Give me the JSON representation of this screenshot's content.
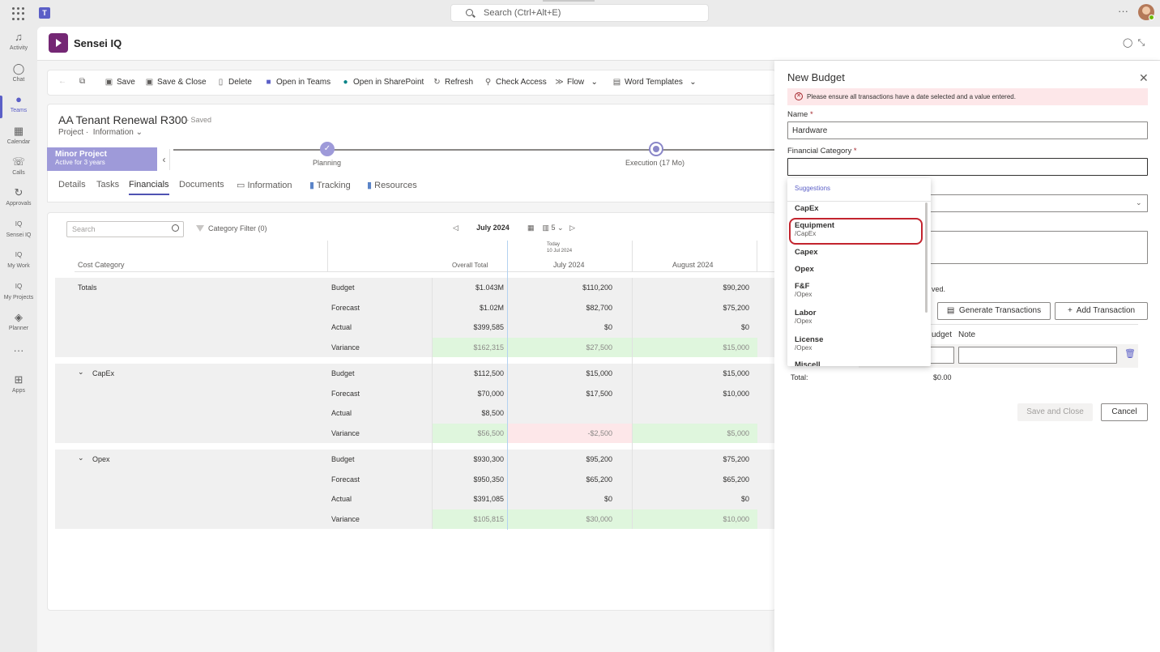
{
  "topbar": {
    "search_placeholder": "Search (Ctrl+Alt+E)",
    "more": "···"
  },
  "rail": [
    {
      "label": "Activity",
      "icon": "bell-icon",
      "glyph": "♫"
    },
    {
      "label": "Chat",
      "icon": "chat-icon",
      "glyph": "◯"
    },
    {
      "label": "Teams",
      "icon": "teams-icon",
      "glyph": "●"
    },
    {
      "label": "Calendar",
      "icon": "calendar-icon",
      "glyph": "▦"
    },
    {
      "label": "Calls",
      "icon": "phone-icon",
      "glyph": "☏"
    },
    {
      "label": "Approvals",
      "icon": "approvals-icon",
      "glyph": "↻"
    },
    {
      "label": "Sensei IQ",
      "icon": "sensei-iq-icon",
      "glyph": "IQ"
    },
    {
      "label": "My Work",
      "icon": "my-work-icon",
      "glyph": "IQ"
    },
    {
      "label": "My Projects",
      "icon": "my-projects-icon",
      "glyph": "IQ"
    },
    {
      "label": "Planner",
      "icon": "planner-icon",
      "glyph": "◈"
    },
    {
      "label": "",
      "icon": "more-apps-icon",
      "glyph": "···"
    },
    {
      "label": "Apps",
      "icon": "apps-icon",
      "glyph": "⊞"
    }
  ],
  "app": {
    "title": "Sensei IQ"
  },
  "commands": {
    "save": "Save",
    "save_close": "Save & Close",
    "delete": "Delete",
    "open_teams": "Open in Teams",
    "open_sharepoint": "Open in SharePoint",
    "refresh": "Refresh",
    "check_access": "Check Access",
    "flow": "Flow",
    "word_templates": "Word Templates"
  },
  "record": {
    "title": "AA Tenant Renewal R300",
    "saved": "- Saved",
    "entity": "Project",
    "form": "Information",
    "stage_name": "Minor Project",
    "stage_sub": "Active for 3 years",
    "stage1": "Planning",
    "stage2": "Execution  (17 Mo)"
  },
  "tabs": [
    "Details",
    "Tasks",
    "Financials",
    "Documents",
    "Information",
    "Tracking",
    "Resources"
  ],
  "grid": {
    "search_placeholder": "Search",
    "category_filter": "Category Filter (0)",
    "month": "July 2024",
    "months_count": "5",
    "headers": {
      "cost_category": "Cost Category",
      "overall_total": "Overall Total",
      "today": "Today",
      "today_date": "10 Jul 2024",
      "jul": "July 2024",
      "aug": "August 2024"
    },
    "groups": [
      {
        "name": "Totals",
        "rows": [
          {
            "type": "Budget",
            "total": "$1.043M",
            "jul": "$110,200",
            "aug": "$90,200"
          },
          {
            "type": "Forecast",
            "total": "$1.02M",
            "jul": "$82,700",
            "aug": "$75,200"
          },
          {
            "type": "Actual",
            "total": "$399,585",
            "jul": "$0",
            "aug": "$0"
          },
          {
            "type": "Variance",
            "total": "$162,315",
            "jul": "$27,500",
            "aug": "$15,000"
          }
        ]
      },
      {
        "name": "CapEx",
        "rows": [
          {
            "type": "Budget",
            "total": "$112,500",
            "jul": "$15,000",
            "aug": "$15,000"
          },
          {
            "type": "Forecast",
            "total": "$70,000",
            "jul": "$17,500",
            "aug": "$10,000"
          },
          {
            "type": "Actual",
            "total": "$8,500",
            "jul": "",
            "aug": ""
          },
          {
            "type": "Variance",
            "total": "$56,500",
            "jul": "-$2,500",
            "aug": "$5,000"
          }
        ]
      },
      {
        "name": "Opex",
        "rows": [
          {
            "type": "Budget",
            "total": "$930,300",
            "jul": "$95,200",
            "aug": "$75,200"
          },
          {
            "type": "Forecast",
            "total": "$950,350",
            "jul": "$65,200",
            "aug": "$65,200"
          },
          {
            "type": "Actual",
            "total": "$391,085",
            "jul": "$0",
            "aug": "$0"
          },
          {
            "type": "Variance",
            "total": "$105,815",
            "jul": "$30,000",
            "aug": "$10,000"
          }
        ]
      }
    ]
  },
  "panel": {
    "title": "New Budget",
    "error": "Please ensure all transactions have a date selected and a value entered.",
    "name_label": "Name",
    "name_value": "Hardware",
    "fin_cat_label": "Financial Category",
    "fin_cat_value": "",
    "saved_fragment": "ved.",
    "generate": "Generate Transactions",
    "add": "Add Transaction",
    "col_budget": "udget",
    "col_note": "Note",
    "total_label": "Total:",
    "total_value": "$0.00",
    "save_close": "Save and Close",
    "cancel": "Cancel"
  },
  "suggestions": {
    "header": "Suggestions",
    "items": [
      {
        "main": "CapEx",
        "sub": ""
      },
      {
        "main": "Equipment",
        "sub": "/CapEx"
      },
      {
        "main": "Capex",
        "sub": ""
      },
      {
        "main": "Opex",
        "sub": ""
      },
      {
        "main": "F&F",
        "sub": "/Opex"
      },
      {
        "main": "Labor",
        "sub": "/Opex"
      },
      {
        "main": "License",
        "sub": "/Opex"
      },
      {
        "main": "Miscell",
        "sub": ""
      }
    ]
  }
}
